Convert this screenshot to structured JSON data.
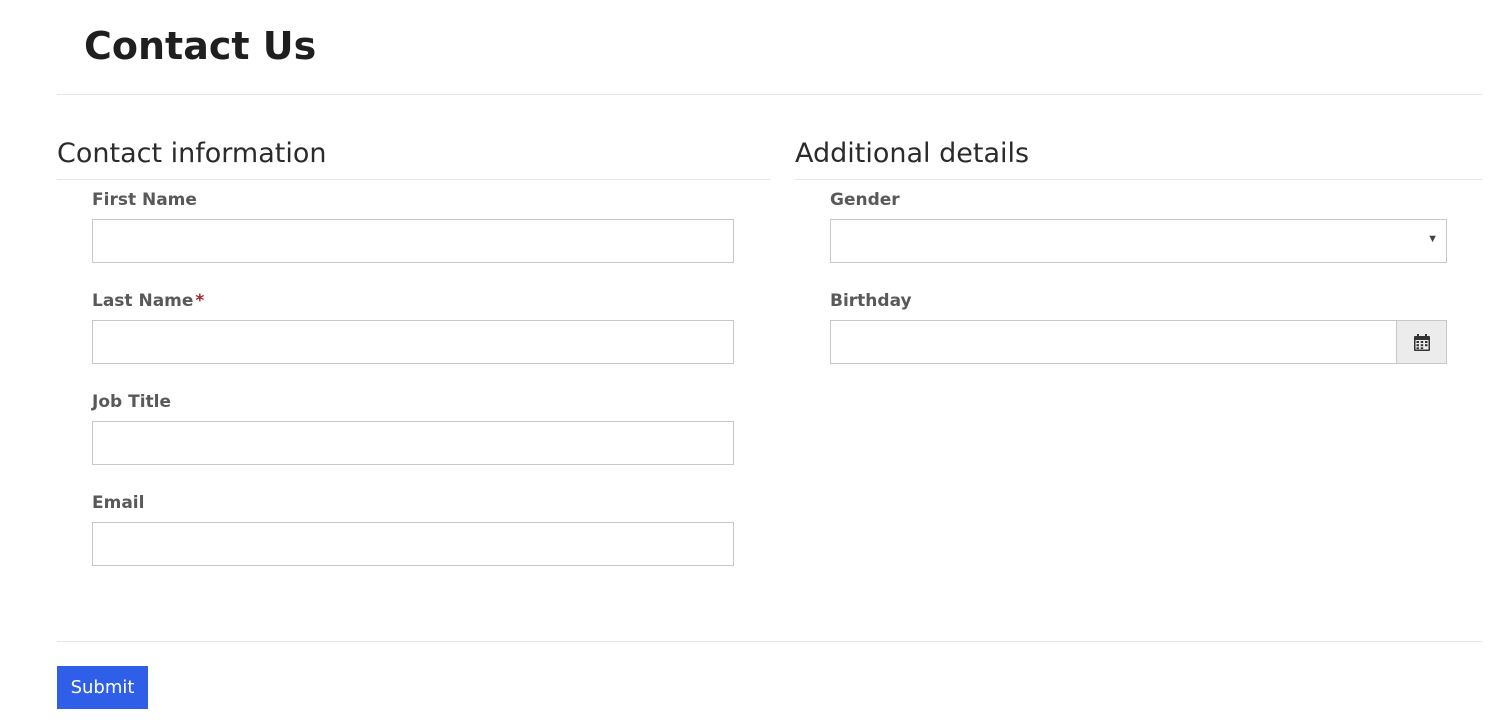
{
  "page": {
    "title": "Contact Us"
  },
  "contact_section": {
    "title": "Contact information",
    "fields": {
      "first_name": {
        "label": "First Name",
        "value": "",
        "placeholder": ""
      },
      "last_name": {
        "label": "Last Name",
        "required_marker": "*",
        "value": "",
        "placeholder": ""
      },
      "job_title": {
        "label": "Job Title",
        "value": "",
        "placeholder": ""
      },
      "email": {
        "label": "Email",
        "value": "",
        "placeholder": ""
      }
    }
  },
  "details_section": {
    "title": "Additional details",
    "fields": {
      "gender": {
        "label": "Gender",
        "selected": "",
        "arrow_icon": "caret-down-icon"
      },
      "birthday": {
        "label": "Birthday",
        "value": "",
        "placeholder": "",
        "button_icon": "calendar-icon"
      }
    }
  },
  "actions": {
    "submit_label": "Submit"
  },
  "colors": {
    "accent": "#2f5ee8",
    "required": "#a4262c",
    "label": "#595959",
    "border": "#c8c8c8",
    "divider": "#e6e6e6"
  }
}
